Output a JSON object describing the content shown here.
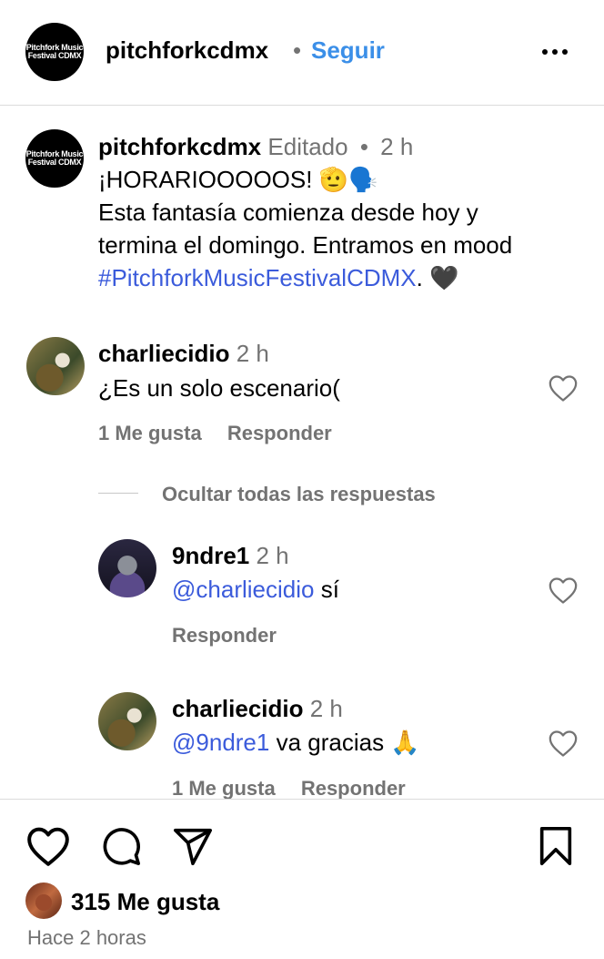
{
  "header": {
    "logo_line1": "Pitchfork Music",
    "logo_line2": "Festival CDMX",
    "username": "pitchforkcdmx",
    "dot": "•",
    "follow_label": "Seguir"
  },
  "caption": {
    "username": "pitchforkcdmx",
    "edited": "Editado",
    "dot": "•",
    "time": "2 h",
    "line1": "¡HORARIOOOOOS! 🫡🗣️",
    "line2": "Esta fantasía comienza desde hoy y",
    "line3": "termina el domingo. Entramos en mood",
    "hashtag": "#PitchforkMusicFestivalCDMX",
    "line4_end": ". 🖤"
  },
  "comments": [
    {
      "username": "charliecidio",
      "time": "2 h",
      "text": "¿Es un solo escenario(",
      "likes": "1 Me gusta",
      "reply": "Responder"
    }
  ],
  "hide_replies": "Ocultar todas las respuestas",
  "replies": [
    {
      "username": "9ndre1",
      "time": "2 h",
      "mention": "@charliecidio",
      "text": " sí",
      "reply": "Responder"
    },
    {
      "username": "charliecidio",
      "time": "2 h",
      "mention": "@9ndre1",
      "text": " va gracias 🙏",
      "likes": "1 Me gusta",
      "reply": "Responder"
    }
  ],
  "footer": {
    "likes_count": "315 Me gusta",
    "time_ago": "Hace 2 horas"
  }
}
